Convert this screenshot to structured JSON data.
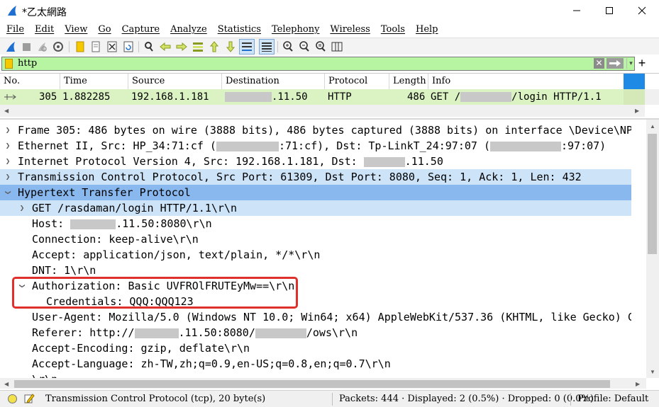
{
  "window": {
    "title": "*乙太網路",
    "minimize_label": "—",
    "maximize_label": "☐",
    "close_label": "✕"
  },
  "menu": [
    "File",
    "Edit",
    "View",
    "Go",
    "Capture",
    "Analyze",
    "Statistics",
    "Telephony",
    "Wireless",
    "Tools",
    "Help"
  ],
  "filter": {
    "value": "http",
    "clear_label": "✕",
    "dropdown_label": "▾",
    "add_label": "+"
  },
  "packet_list": {
    "columns": [
      "No.",
      "Time",
      "Source",
      "Destination",
      "Protocol",
      "Length",
      "Info"
    ],
    "row": {
      "no": "305",
      "time": "1.882285",
      "source": "192.168.1.181",
      "destination_suffix": ".11.50",
      "protocol": "HTTP",
      "length": "486",
      "info_prefix": "GET /",
      "info_suffix": "/login HTTP/1.1"
    },
    "row_color": "#dbf2c2"
  },
  "details": {
    "frame": "Frame 305: 486 bytes on wire (3888 bits), 486 bytes captured (3888 bits) on interface \\Device\\NP",
    "ethernet_a": "Ethernet II, Src: HP_34:71:cf (",
    "ethernet_b": ":71:cf), Dst: Tp-LinkT_24:97:07 (",
    "ethernet_c": ":97:07)",
    "ip_a": "Internet Protocol Version 4, Src: 192.168.1.181, Dst: ",
    "ip_b": ".11.50",
    "tcp": "Transmission Control Protocol, Src Port: 61309, Dst Port: 8080, Seq: 1, Ack: 1, Len: 432",
    "http": "Hypertext Transfer Protocol",
    "get_line": "GET /rasdaman/login HTTP/1.1\\r\\n",
    "host_a": "Host: ",
    "host_b": ".11.50:8080\\r\\n",
    "connection": "Connection: keep-alive\\r\\n",
    "accept": "Accept: application/json, text/plain, */*\\r\\n",
    "dnt": "DNT: 1\\r\\n",
    "authorization": "Authorization: Basic UVFROlFRUTEyMw==\\r\\n",
    "credentials": "Credentials: QQQ:QQQ123",
    "user_agent": "User-Agent: Mozilla/5.0 (Windows NT 10.0; Win64; x64) AppleWebKit/537.36 (KHTML, like Gecko) C",
    "referer_a": "Referer: http://",
    "referer_b": ".11.50:8080/",
    "referer_c": "/ows\\r\\n",
    "accept_encoding": "Accept-Encoding: gzip, deflate\\r\\n",
    "accept_language": "Accept-Language: zh-TW,zh;q=0.9,en-US;q=0.8,en;q=0.7\\r\\n",
    "crlf": "\\r\\n",
    "highlight_color": "#e0302c",
    "selected_color": "#88b8ee"
  },
  "status": {
    "protocol": "Transmission Control Protocol (tcp), 20 byte(s)",
    "packets": "Packets: 444 · Displayed: 2 (0.5%) · Dropped: 0 (0.0%)",
    "profile": "Profile: Default"
  }
}
